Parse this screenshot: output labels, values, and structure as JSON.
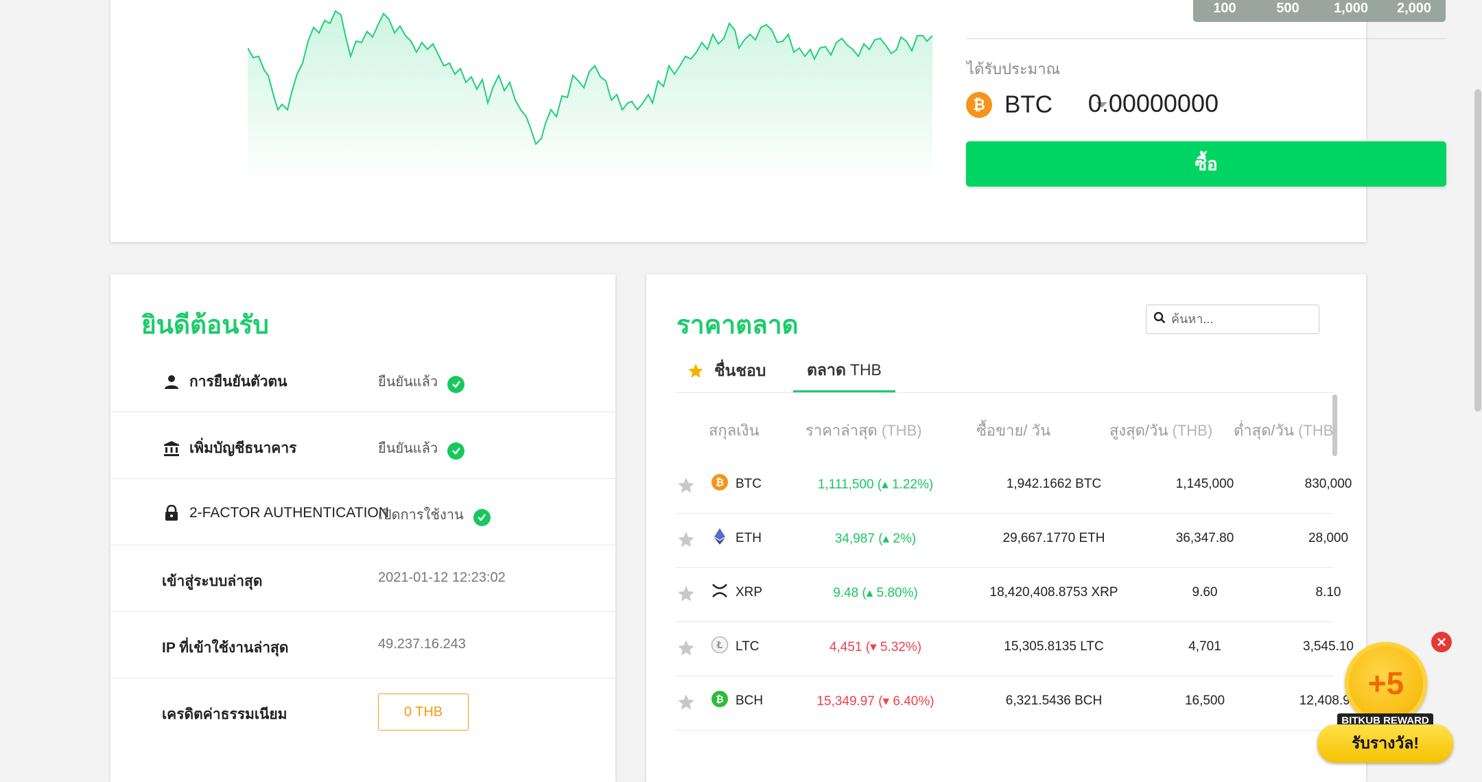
{
  "order": {
    "amount_presets": [
      "100",
      "500",
      "1,000",
      "2,000"
    ],
    "estimate_label": "ได้รับประมาณ",
    "coin": "BTC",
    "coin_icon": "bitcoin-icon",
    "estimate_value": "0.00000000",
    "buy_label": "ซื้อ"
  },
  "colors": {
    "brand_green": "#1bcc6b",
    "buy_button": "#00d563",
    "price_up": "#19c75f",
    "price_down": "#f1414a",
    "fee_orange": "#f39c12",
    "chart_line": "#1fd07a"
  },
  "welcome": {
    "title": "ยินดีต้อนรับ",
    "rows": [
      {
        "label": "การยืนยันตัวตน",
        "icon": "user-icon",
        "value": "ยืนยันแล้ว",
        "verified": true
      },
      {
        "label": "เพิ่มบัญชีธนาคาร",
        "icon": "bank-icon",
        "value": "ยืนยันแล้ว",
        "verified": true
      },
      {
        "label": "2-FACTOR AUTHENTICATION",
        "icon": "lock-icon",
        "value": "เปิดการใช้งาน",
        "verified": true
      },
      {
        "label": "เข้าสู่ระบบล่าสุด",
        "value": "2021-01-12 12:23:02"
      },
      {
        "label": "IP ที่เข้าใช้งานล่าสุด",
        "value": "49.237.16.243"
      },
      {
        "label": "เครดิตค่าธรรมเนียม",
        "value": "0 THB"
      }
    ]
  },
  "market": {
    "title": "ราคาตลาด",
    "search_placeholder": "ค้นหา...",
    "tabs": {
      "favorites": "ชื่นชอบ",
      "market_prefix": "ตลาด",
      "market_suffix": "THB"
    },
    "columns": {
      "currency": "สกุลเงิน",
      "last_price": "ราคาล่าสุด",
      "last_price_unit": "(THB)",
      "volume": "ซื้อขาย/ วัน",
      "high": "สูงสุด/วัน",
      "high_unit": "(THB)",
      "low": "ต่ำสุด/วัน",
      "low_unit": "(THB)"
    },
    "rows": [
      {
        "symbol": "BTC",
        "icon": "bitcoin-icon",
        "price": "1,111,500",
        "change": "1.22%",
        "direction": "up",
        "volume": "1,942.1662 BTC",
        "high": "1,145,000",
        "low": "830,000"
      },
      {
        "symbol": "ETH",
        "icon": "ethereum-icon",
        "price": "34,987",
        "change": "2%",
        "direction": "up",
        "volume": "29,667.1770 ETH",
        "high": "36,347.80",
        "low": "28,000"
      },
      {
        "symbol": "XRP",
        "icon": "xrp-icon",
        "price": "9.48",
        "change": "5.80%",
        "direction": "up",
        "volume": "18,420,408.8753 XRP",
        "high": "9.60",
        "low": "8.10"
      },
      {
        "symbol": "LTC",
        "icon": "litecoin-icon",
        "price": "4,451",
        "change": "5.32%",
        "direction": "down",
        "volume": "15,305.8135 LTC",
        "high": "4,701",
        "low": "3,545.10"
      },
      {
        "symbol": "BCH",
        "icon": "bitcoin-cash-icon",
        "price": "15,349.97",
        "change": "6.40%",
        "direction": "down",
        "volume": "6,321.5436 BCH",
        "high": "16,500",
        "low": "12,408.97"
      }
    ]
  },
  "reward": {
    "points": "+5",
    "tag": "BITKUB REWARD",
    "cta": "รับรางวัล!"
  }
}
